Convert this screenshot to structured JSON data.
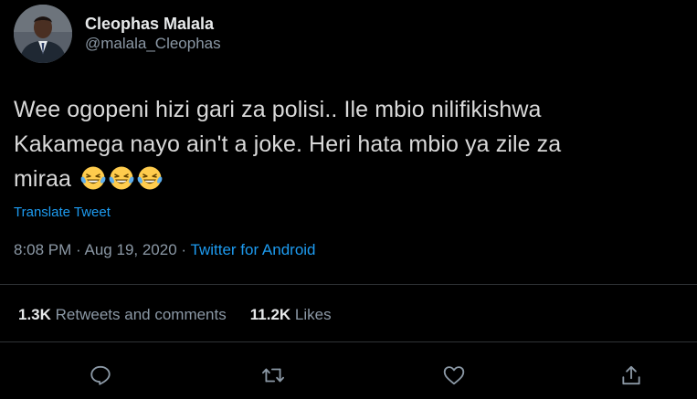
{
  "tweet": {
    "author": {
      "display_name": "Cleophas Malala",
      "handle": "@malala_Cleophas"
    },
    "text_lines": [
      "Wee ogopeni hizi gari za polisi.. Ile mbio nilifikishwa",
      "Kakamega nayo ain't a joke. Heri hata mbio ya zile za",
      "miraa"
    ],
    "emoji": [
      "laughing-tears-emoji",
      "laughing-tears-emoji",
      "laughing-tears-emoji"
    ],
    "translate_label": "Translate Tweet",
    "time": "8:08 PM",
    "separator": "·",
    "date": "Aug 19, 2020",
    "source": "Twitter for Android",
    "stats": {
      "retweets_count": "1.3K",
      "retweets_label": "Retweets and comments",
      "likes_count": "11.2K",
      "likes_label": "Likes"
    },
    "actions": [
      "reply-icon",
      "retweet-icon",
      "like-icon",
      "share-icon"
    ]
  },
  "colors": {
    "background": "#000000",
    "accent": "#1d9bf0",
    "secondary_text": "#8b98a5",
    "divider": "#2f3336"
  }
}
